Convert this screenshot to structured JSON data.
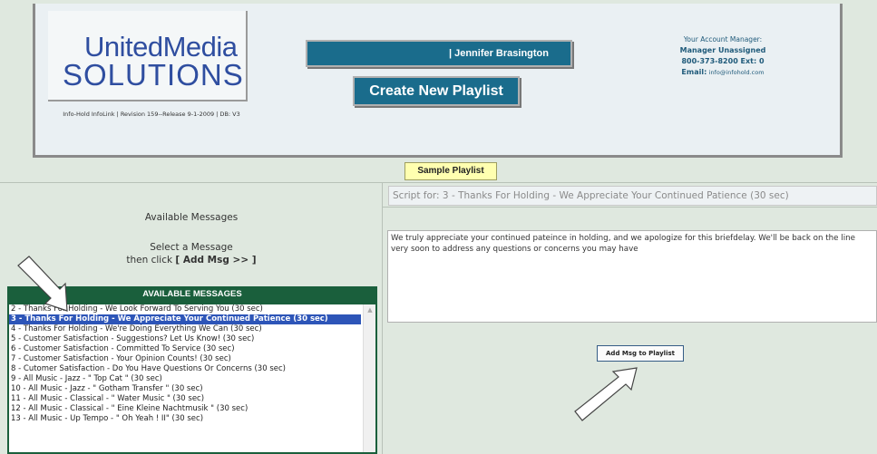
{
  "logo": {
    "line1": "UnitedMedia",
    "line2": "SOLUTIONS"
  },
  "revision_text": "Info-Hold InfoLink | Revision 159--Release 9-1-2009 | DB: V3",
  "user": {
    "name": "| Jennifer Brasington"
  },
  "create_playlist_label": "Create New Playlist",
  "account": {
    "label": "Your Account Manager:",
    "manager": "Manager Unassigned",
    "phone": "800-373-8200 Ext: 0",
    "email_label": "Email:",
    "email": "info@infohold.com"
  },
  "sample_playlist_tab": "Sample Playlist",
  "script_title": "Script for: 3 - Thanks For Holding - We Appreciate Your Continued Patience (30 sec)",
  "left_panel": {
    "heading": "Available Messages",
    "instruction_line1": "Select a Message",
    "instruction_then": "then click ",
    "instruction_bold": "[ Add Msg >> ]"
  },
  "list": {
    "header": "AVAILABLE MESSAGES",
    "items": [
      "2 - Thanks For Holding - We Look Forward To Serving You (30 sec)",
      "3 - Thanks For Holding - We Appreciate Your Continued Patience (30 sec)",
      "4 - Thanks For Holding - We're Doing Everything We Can (30 sec)",
      "5 - Customer Satisfaction - Suggestions? Let Us Know! (30 sec)",
      "6 - Customer Satisfaction - Committed To Service (30 sec)",
      "7 - Customer Satisfaction - Your Opinion Counts! (30 sec)",
      "8 - Cutomer Satisfaction - Do You Have Questions Or Concerns (30 sec)",
      "9 - All Music - Jazz - \" Top Cat \" (30 sec)",
      "10 - All Music - Jazz - \" Gotham Transfer \" (30 sec)",
      "11 - All Music - Classical - \" Water Music \" (30 sec)",
      "12 - All Music - Classical - \" Eine Kleine Nachtmusik \" (30 sec)",
      "13 - All Music - Up Tempo - \" Oh Yeah ! II\" (30 sec)"
    ],
    "selected_index": 1
  },
  "script_text": "We truly appreciate your continued pateince in holding, and we apologize for this briefdelay. We'll be back on the line very soon to address any questions or concerns you may have",
  "add_msg_label": "Add Msg to Playlist",
  "colors": {
    "accent": "#1a6c8c",
    "list_header": "#1a5f3c",
    "selected": "#2d55b8",
    "tab_yellow": "#ffffb0"
  }
}
